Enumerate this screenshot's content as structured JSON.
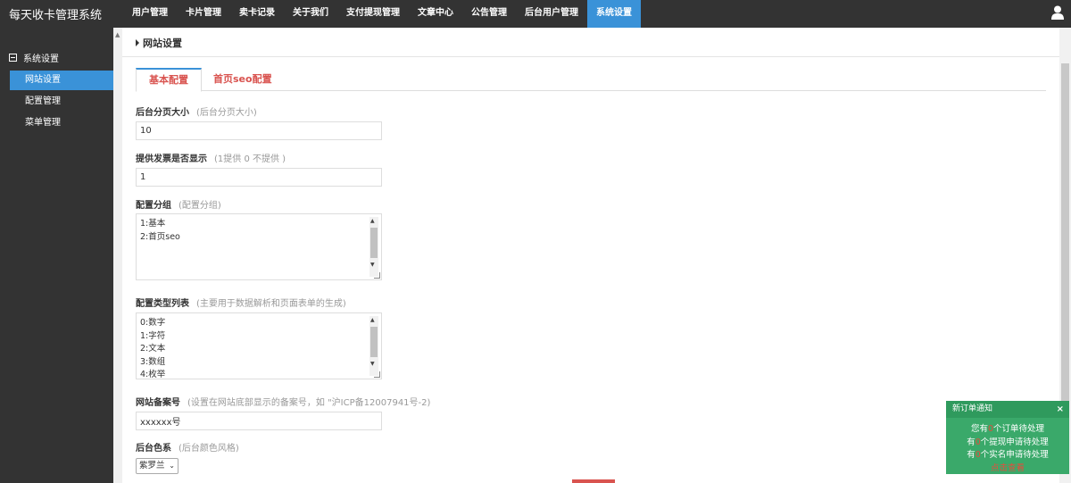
{
  "app": {
    "title": "每天收卡管理系统"
  },
  "nav": {
    "items": [
      {
        "label": "用户管理"
      },
      {
        "label": "卡片管理"
      },
      {
        "label": "卖卡记录"
      },
      {
        "label": "关于我们"
      },
      {
        "label": "支付提现管理"
      },
      {
        "label": "文章中心"
      },
      {
        "label": "公告管理"
      },
      {
        "label": "后台用户管理"
      },
      {
        "label": "系统设置",
        "active": true
      }
    ]
  },
  "sidebar": {
    "group_label": "系统设置",
    "items": [
      {
        "label": "网站设置",
        "active": true
      },
      {
        "label": "配置管理"
      },
      {
        "label": "菜单管理"
      }
    ]
  },
  "page": {
    "title": "网站设置"
  },
  "tabs": [
    {
      "label": "基本配置",
      "active": true
    },
    {
      "label": "首页seo配置"
    }
  ],
  "fields": {
    "page_size": {
      "label": "后台分页大小",
      "hint": "(后台分页大小)",
      "value": "10"
    },
    "invoice": {
      "label": "提供发票是否显示",
      "hint": "(1提供 0 不提供 )",
      "value": "1"
    },
    "config_group": {
      "label": "配置分组",
      "hint": "(配置分组)",
      "lines": [
        "1:基本",
        "2:首页seo"
      ]
    },
    "config_types": {
      "label": "配置类型列表",
      "hint": "(主要用于数据解析和页面表单的生成)",
      "lines": [
        "0:数字",
        "1:字符",
        "2:文本",
        "3:数组",
        "4:枚举"
      ]
    },
    "icp": {
      "label": "网站备案号",
      "hint": "(设置在网站底部显示的备案号，如 \"沪ICP备12007941号-2)",
      "value": "xxxxxx号"
    },
    "theme": {
      "label": "后台色系",
      "hint": "(后台颜色风格)",
      "selected": "紫罗兰"
    }
  },
  "notification": {
    "title": "新订单通知",
    "close": "×",
    "lines": [
      {
        "prefix": "您有",
        "count": "0",
        "suffix": "个订单待处理"
      },
      {
        "prefix": "有",
        "count": "0",
        "suffix": "个提现申请待处理"
      },
      {
        "prefix": "有",
        "count": "0",
        "suffix": "个实名申请待处理"
      }
    ],
    "link": "点击查看"
  },
  "colors": {
    "topbar": "#333333",
    "accent": "#3a92d8",
    "tab_text": "#d9534f",
    "notify_bg": "#3aa96a"
  }
}
